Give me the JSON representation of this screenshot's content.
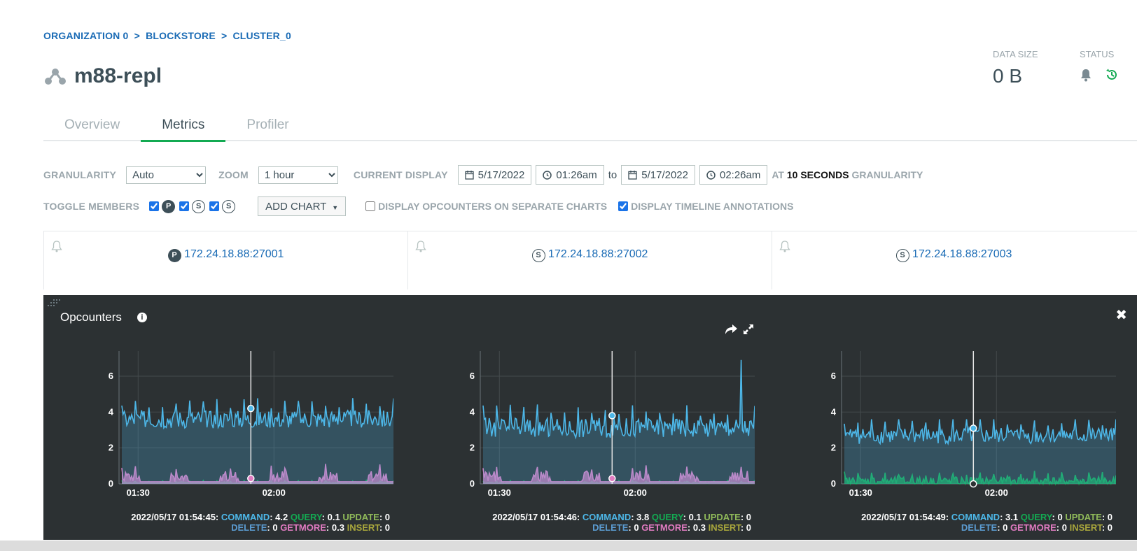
{
  "breadcrumb": {
    "org": "ORGANIZATION 0",
    "sep1": ">",
    "project": "BLOCKSTORE",
    "sep2": ">",
    "cluster": "CLUSTER_0"
  },
  "page_title": "m88-repl",
  "stats": {
    "data_size_label": "DATA SIZE",
    "data_size_value": "0 B",
    "status_label": "STATUS"
  },
  "tabs": [
    {
      "label": "Overview"
    },
    {
      "label": "Metrics"
    },
    {
      "label": "Profiler"
    }
  ],
  "controls": {
    "granularity_label": "GRANULARITY",
    "granularity_value": "Auto",
    "zoom_label": "ZOOM",
    "zoom_value": "1 hour",
    "current_display_label": "CURRENT DISPLAY",
    "start_date": "5/17/2022",
    "start_time": "01:26am",
    "to_label": "to",
    "end_date": "5/17/2022",
    "end_time": "02:26am",
    "at_label": "AT",
    "granularity_bold": "10 SECONDS",
    "granularity_suffix": "GRANULARITY",
    "toggle_members_label": "TOGGLE MEMBERS",
    "member_badges": [
      "P",
      "S",
      "S"
    ],
    "add_chart_label": "ADD CHART",
    "separate_charts_label": "DISPLAY OPCOUNTERS ON SEPARATE CHARTS",
    "timeline_annotations_label": "DISPLAY TIMELINE ANNOTATIONS"
  },
  "members": [
    {
      "badge": "P",
      "host": "172.24.18.88:27001"
    },
    {
      "badge": "S",
      "host": "172.24.18.88:27002"
    },
    {
      "badge": "S",
      "host": "172.24.18.88:27003"
    }
  ],
  "chart_panel": {
    "title": "Opcounters",
    "info_glyph": "i",
    "close_glyph": "✖"
  },
  "colors": {
    "command": "#4db7e8",
    "query": "#13aa52",
    "update": "#8fb959",
    "delete": "#5b9bd0",
    "getmore": "#e07bc1",
    "insert": "#a8a63c",
    "accent": "#13aa52",
    "link": "#1a6bb5"
  },
  "chart_data": [
    {
      "type": "area",
      "x_ticks": [
        "01:30",
        "02:00"
      ],
      "y_ticks": [
        0,
        2,
        4,
        6
      ],
      "ylim": [
        0,
        7.4
      ],
      "series": [
        {
          "name": "COMMAND",
          "baseline": 3.4,
          "amplitude": 1.0,
          "peak": 5.6
        },
        {
          "name": "GETMORE",
          "baseline": 0.3,
          "amplitude": 0.6,
          "peak": 1.8
        },
        {
          "name": "QUERY",
          "baseline": 0.05,
          "amplitude": 0.1,
          "peak": 0.5
        }
      ],
      "cursor": {
        "timestamp": "2022/05/17 01:54:45:",
        "values": {
          "COMMAND": "4.2",
          "QUERY": "0.1",
          "UPDATE": "0",
          "DELETE": "0",
          "GETMORE": "0.3",
          "INSERT": "0"
        }
      }
    },
    {
      "type": "area",
      "x_ticks": [
        "01:30",
        "02:00"
      ],
      "y_ticks": [
        0,
        2,
        4,
        6
      ],
      "ylim": [
        0,
        7.4
      ],
      "series": [
        {
          "name": "COMMAND",
          "baseline": 2.9,
          "amplitude": 1.1,
          "peak": 6.9
        },
        {
          "name": "GETMORE",
          "baseline": 0.3,
          "amplitude": 0.6,
          "peak": 1.3
        },
        {
          "name": "QUERY",
          "baseline": 0.05,
          "amplitude": 0.1,
          "peak": 0.4
        }
      ],
      "cursor": {
        "timestamp": "2022/05/17 01:54:46:",
        "values": {
          "COMMAND": "3.8",
          "QUERY": "0.1",
          "UPDATE": "0",
          "DELETE": "0",
          "GETMORE": "0.3",
          "INSERT": "0"
        }
      }
    },
    {
      "type": "area",
      "x_ticks": [
        "01:30",
        "02:00"
      ],
      "y_ticks": [
        0,
        2,
        4,
        6
      ],
      "ylim": [
        0,
        7.4
      ],
      "series": [
        {
          "name": "COMMAND",
          "baseline": 2.5,
          "amplitude": 0.9,
          "peak": 3.6
        },
        {
          "name": "GETMORE",
          "baseline": 0,
          "amplitude": 0,
          "peak": 0
        },
        {
          "name": "QUERY",
          "baseline": 0.05,
          "amplitude": 0.5,
          "peak": 0.8
        }
      ],
      "cursor": {
        "timestamp": "2022/05/17 01:54:49:",
        "values": {
          "COMMAND": "3.1",
          "QUERY": "0",
          "UPDATE": "0",
          "DELETE": "0",
          "GETMORE": "0",
          "INSERT": "0"
        }
      }
    }
  ]
}
